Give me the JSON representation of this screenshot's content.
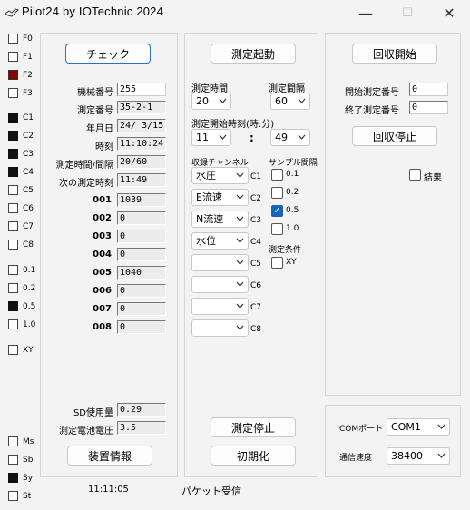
{
  "window": {
    "title": "Pilot24 by IOTechnic 2024",
    "icon": "bird-icon",
    "minimize": "—",
    "maximize": "☐",
    "close": "✕"
  },
  "left_checks": [
    {
      "label": "F0",
      "state": "off"
    },
    {
      "label": "F1",
      "state": "off"
    },
    {
      "label": "F2",
      "state": "red"
    },
    {
      "label": "F3",
      "state": "off"
    },
    {
      "label": "C1",
      "state": "on"
    },
    {
      "label": "C2",
      "state": "on"
    },
    {
      "label": "C3",
      "state": "on"
    },
    {
      "label": "C4",
      "state": "on"
    },
    {
      "label": "C5",
      "state": "off"
    },
    {
      "label": "C6",
      "state": "off"
    },
    {
      "label": "C7",
      "state": "off"
    },
    {
      "label": "C8",
      "state": "off"
    },
    {
      "label": "0.1",
      "state": "off"
    },
    {
      "label": "0.2",
      "state": "off"
    },
    {
      "label": "0.5",
      "state": "on"
    },
    {
      "label": "1.0",
      "state": "off"
    },
    {
      "label": "XY",
      "state": "off"
    },
    {
      "label": "Ms",
      "state": "off"
    },
    {
      "label": "Sb",
      "state": "off"
    },
    {
      "label": "Sy",
      "state": "on"
    },
    {
      "label": "St",
      "state": "off"
    }
  ],
  "left_panel": {
    "check_button": "チェック",
    "fields": [
      {
        "label": "機械番号",
        "value": "255",
        "editable": true
      },
      {
        "label": "測定番号",
        "value": "35-2-1",
        "editable": false
      },
      {
        "label": "年月日",
        "value": "24/ 3/15",
        "editable": false
      },
      {
        "label": "時刻",
        "value": "11:10:24",
        "editable": false
      },
      {
        "label": "測定時間/間隔",
        "value": "20/60",
        "editable": false
      },
      {
        "label": "次の測定時刻",
        "value": "11:49",
        "editable": false
      }
    ],
    "channels": [
      {
        "label": "001",
        "value": "1039"
      },
      {
        "label": "002",
        "value": "0"
      },
      {
        "label": "003",
        "value": "0"
      },
      {
        "label": "004",
        "value": "0"
      },
      {
        "label": "005",
        "value": "1040"
      },
      {
        "label": "006",
        "value": "0"
      },
      {
        "label": "007",
        "value": "0"
      },
      {
        "label": "008",
        "value": "0"
      }
    ],
    "sd_label": "SD使用量",
    "sd_value": "0.29",
    "battery_label": "測定電池電圧",
    "battery_value": "3.5",
    "device_info_button": "装置情報"
  },
  "mid_panel": {
    "start_button": "測定起動",
    "duration_label": "測定時間",
    "duration_value": "20",
    "interval_label": "測定間隔",
    "interval_value": "60",
    "start_time_label": "測定開始時刻(時:分)",
    "hour_value": "11",
    "colon": ":",
    "minute_value": "49",
    "channel_header": "収録チャンネル",
    "sampling_header": "サンプル間隔",
    "channel_selects": [
      {
        "value": "水圧",
        "tag": "C1"
      },
      {
        "value": "E流速",
        "tag": "C2"
      },
      {
        "value": "N流速",
        "tag": "C3"
      },
      {
        "value": "水位",
        "tag": "C4"
      },
      {
        "value": "",
        "tag": "C5"
      },
      {
        "value": "",
        "tag": "C6"
      },
      {
        "value": "",
        "tag": "C7"
      },
      {
        "value": "",
        "tag": "C8"
      }
    ],
    "sampling_options": [
      {
        "label": "0.1",
        "checked": false
      },
      {
        "label": "0.2",
        "checked": false
      },
      {
        "label": "0.5",
        "checked": true
      },
      {
        "label": "1.0",
        "checked": false
      }
    ],
    "condition_header": "測定条件",
    "xy_label": "XY",
    "stop_button": "測定停止",
    "init_button": "初期化"
  },
  "right_panel": {
    "collect_start_button": "回収開始",
    "start_no_label": "開始測定番号",
    "start_no_value": "0",
    "end_no_label": "終了測定番号",
    "end_no_value": "0",
    "collect_stop_button": "回収停止",
    "result_label": "結果",
    "com_label": "COMポート",
    "com_value": "COM1",
    "baud_label": "通信速度",
    "baud_value": "38400"
  },
  "status": {
    "time": "11:11:05",
    "message": "パケット受信"
  },
  "colors": {
    "accent": "#2a6fca",
    "checked_blue": "#1565c0",
    "flag_red": "#8b0000"
  }
}
